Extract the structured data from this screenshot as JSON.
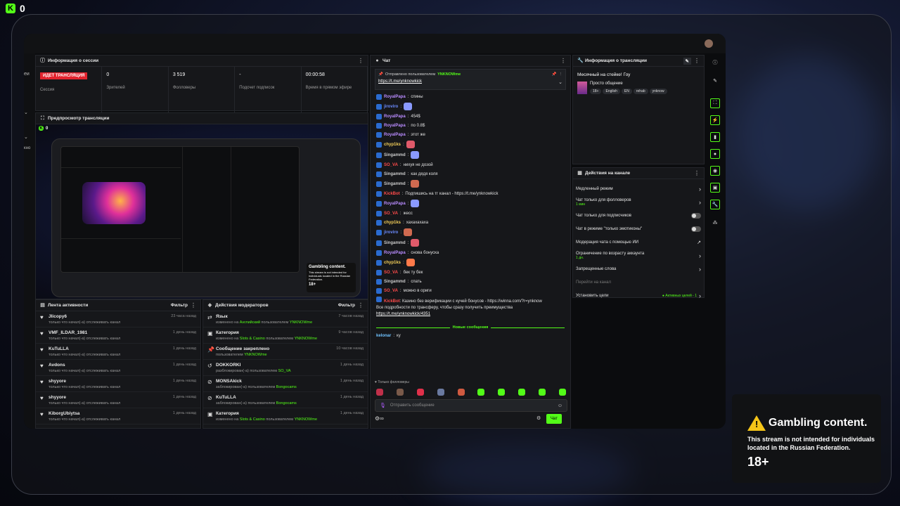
{
  "brand": {
    "logo": "K",
    "count": "0"
  },
  "session": {
    "title": "Информация о сессии",
    "live_badge": "ИДЕТ ТРАНСЛЯЦИЯ",
    "stats": [
      {
        "value": "",
        "label": "Сессия"
      },
      {
        "value": "0",
        "label": "Зрителей"
      },
      {
        "value": "3 519",
        "label": "Фолловеры"
      },
      {
        "value": "-",
        "label": "Подсчет подписок"
      },
      {
        "value": "00:00:58",
        "label": "Время в прямом эфире"
      }
    ]
  },
  "preview": {
    "title": "Предпросмотр трансляции",
    "logo": "K",
    "count": "0",
    "mini_gambling": {
      "title": "Gambling content.",
      "text": "This stream is not intended for individuals located in the Russian Federation.",
      "age": "18+"
    }
  },
  "activity": {
    "title": "Лента активности",
    "filter": "Фильтр",
    "items": [
      {
        "name": "Jlicopy6",
        "sub": "только что начал(-а) отслеживать канал",
        "time": "23 часа назад"
      },
      {
        "name": "VMF_ILDAR_1981",
        "sub": "только что начал(-а) отслеживать канал",
        "time": "1 день назад"
      },
      {
        "name": "KuTuLLA",
        "sub": "только что начал(-а) отслеживать канал",
        "time": "1 день назад"
      },
      {
        "name": "Avdons",
        "sub": "только что начал(-а) отслеживать канал",
        "time": "1 день назад"
      },
      {
        "name": "shyyore",
        "sub": "только что начал(-а) отслеживать канал",
        "time": "1 день назад"
      },
      {
        "name": "shyyore",
        "sub": "только что начал(-а) отслеживать канал",
        "time": "1 день назад"
      },
      {
        "name": "KiborgUbiytsa",
        "sub": "только что начал(-а) отслеживать канал",
        "time": "1 день назад"
      }
    ]
  },
  "mod": {
    "title": "Действия модераторов",
    "filter": "Фильтр",
    "items": [
      {
        "icon": "⇄",
        "name": "Язык",
        "pre": "изменено на ",
        "hl": "Английский",
        "mid": " пользователем ",
        "user": "YNKNOWme",
        "time": "7 часов назад"
      },
      {
        "icon": "▣",
        "name": "Категория",
        "pre": "изменено на ",
        "hl": "Slots & Casino",
        "mid": " пользователем ",
        "user": "YNKNOWme",
        "time": "9 часов назад"
      },
      {
        "icon": "📌",
        "name": "Сообщение закреплено",
        "pre": "пользователем ",
        "hl": "",
        "mid": "",
        "user": "YNKNOWme",
        "time": "10 часов назад"
      },
      {
        "icon": "↺",
        "name": "DOKKORKI",
        "pre": "разблокирован(-а) пользователем ",
        "hl": "",
        "mid": "",
        "user": "SO_VA",
        "time": "1 день назад"
      },
      {
        "icon": "⊘",
        "name": "MONSAkick",
        "pre": "заблокирован(-а) пользователем ",
        "hl": "",
        "mid": "",
        "user": "Bongocams",
        "time": "1 день назад"
      },
      {
        "icon": "⊘",
        "name": "KuTuLLA",
        "pre": "заблокирован(-а) пользователем ",
        "hl": "",
        "mid": "",
        "user": "Bongocams",
        "time": "1 день назад"
      },
      {
        "icon": "▣",
        "name": "Категория",
        "pre": "изменено на ",
        "hl": "Slots & Casino",
        "mid": " пользователем ",
        "user": "YNKNOWme",
        "time": "1 день назад"
      }
    ]
  },
  "chat": {
    "title": "Чат",
    "pinned_by": "Отправлено пользователем",
    "pinned_user": "YNKNOWme",
    "pinned_link": "https://t.me/ynknowkick",
    "new_messages": "Новые сообщения",
    "followers_only": "Только фолловеры",
    "placeholder": "Отправить сообщение",
    "send": "Чат",
    "last_user": "kelonar",
    "last_text": "ку",
    "messages": [
      {
        "user": "RoyalPapa",
        "cls": "u-royal",
        "text": "спины"
      },
      {
        "user": "jiroviro",
        "cls": "u-jiro",
        "text": ""
      },
      {
        "user": "RoyalPapa",
        "cls": "u-royal",
        "text": "454$"
      },
      {
        "user": "RoyalPapa",
        "cls": "u-royal",
        "text": "по 0.8$"
      },
      {
        "user": "RoyalPapa",
        "cls": "u-royal",
        "text": "этот же"
      },
      {
        "user": "chyp1ks",
        "cls": "u-chy",
        "text": ""
      },
      {
        "user": "Singammd",
        "cls": "u-sing",
        "text": ""
      },
      {
        "user": "SO_VA",
        "cls": "u-so",
        "text": "нихуя не дозой"
      },
      {
        "user": "Singammd",
        "cls": "u-sing",
        "text": "как дядя коля"
      },
      {
        "user": "Singammd",
        "cls": "u-sing",
        "text": ""
      },
      {
        "user": "KickBot",
        "cls": "u-so",
        "text": "Подпишись на тг канал - https://t.me/ynknowkick"
      },
      {
        "user": "RoyalPapa",
        "cls": "u-royal",
        "text": ""
      },
      {
        "user": "SO_VA",
        "cls": "u-so",
        "text": "жесс"
      },
      {
        "user": "chyp1ks",
        "cls": "u-chy",
        "text": "хахахахаха"
      },
      {
        "user": "jiroviro",
        "cls": "u-jiro",
        "text": ""
      },
      {
        "user": "Singammd",
        "cls": "u-sing",
        "text": ""
      },
      {
        "user": "RoyalPapa",
        "cls": "u-royal",
        "text": "снова бонуска"
      },
      {
        "user": "chyp1ks",
        "cls": "u-chy",
        "text": ""
      },
      {
        "user": "SO_VA",
        "cls": "u-so",
        "text": "бек ту бек"
      },
      {
        "user": "Singammd",
        "cls": "u-sing",
        "text": "спать"
      },
      {
        "user": "SO_VA",
        "cls": "u-so",
        "text": "можно в ориги"
      }
    ],
    "ad_text": "Казино без верификации с кучей бонусов - https://winna.com/?r=ynknow",
    "ad_text2": "Все подробности по трансферу, чтобы сразу получить преимущества",
    "ad_link": "https://t.me/ynknowkick/4351",
    "ad_user": "KickBot"
  },
  "info": {
    "title": "Информация о трансляции",
    "stream_title": "Месячный на стейке! Гоу",
    "category": "Просто общение",
    "tags": [
      "18+",
      "English",
      "EN",
      "rehab",
      "ynknow"
    ]
  },
  "actions": {
    "title": "Действия на канале",
    "items": [
      {
        "label": "Медленный режим",
        "sub": "",
        "ctrl": "chev"
      },
      {
        "label": "Чат только для фолловеров",
        "sub": "1 мин",
        "ctrl": "chev"
      },
      {
        "label": "Чат только для подписчиков",
        "sub": "",
        "ctrl": "toggle"
      },
      {
        "label": "Чат в режиме \"только эмотиконы\"",
        "sub": "",
        "ctrl": "toggle"
      },
      {
        "label": "Модерация чата с помощью ИИ",
        "sub": "",
        "ctrl": "ext"
      },
      {
        "label": "Ограничение по возрасту аккаунта",
        "sub": "1 дн.",
        "ctrl": "chev"
      },
      {
        "label": "Запрещенные слова",
        "sub": "",
        "ctrl": "chev"
      },
      {
        "label": "Перейти на канал",
        "sub": "",
        "ctrl": "none"
      },
      {
        "label": "Установить цели",
        "sub": "",
        "ctrl": "chev",
        "extra": "● Активных целей - 1"
      }
    ]
  },
  "gambling": {
    "title": "Gambling content.",
    "text": "This stream is not intended for individuals located in the Russian Federation.",
    "age": "18+"
  },
  "colors": {
    "accent": "#53fc18",
    "live": "#e3232e",
    "warn": "#f5c518"
  }
}
